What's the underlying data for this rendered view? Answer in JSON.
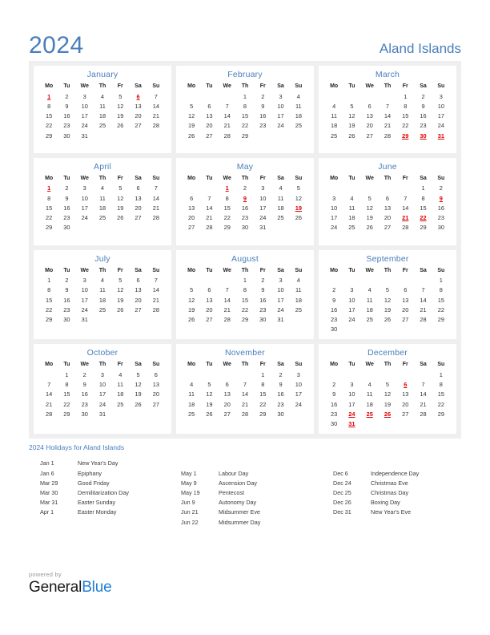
{
  "header": {
    "year": "2024",
    "country": "Aland Islands"
  },
  "calendar": {
    "weekdays": [
      "Mo",
      "Tu",
      "We",
      "Th",
      "Fr",
      "Sa",
      "Su"
    ],
    "months": [
      {
        "name": "January",
        "lead_blanks": 0,
        "days": 31,
        "holidays": [
          1,
          6
        ]
      },
      {
        "name": "February",
        "lead_blanks": 3,
        "days": 29,
        "holidays": []
      },
      {
        "name": "March",
        "lead_blanks": 4,
        "days": 31,
        "holidays": [
          29,
          30,
          31
        ]
      },
      {
        "name": "April",
        "lead_blanks": 0,
        "days": 30,
        "holidays": [
          1
        ]
      },
      {
        "name": "May",
        "lead_blanks": 2,
        "days": 31,
        "holidays": [
          1,
          9,
          19
        ]
      },
      {
        "name": "June",
        "lead_blanks": 5,
        "days": 30,
        "holidays": [
          9,
          21,
          22
        ]
      },
      {
        "name": "July",
        "lead_blanks": 0,
        "days": 31,
        "holidays": []
      },
      {
        "name": "August",
        "lead_blanks": 3,
        "days": 31,
        "holidays": []
      },
      {
        "name": "September",
        "lead_blanks": 6,
        "days": 30,
        "holidays": []
      },
      {
        "name": "October",
        "lead_blanks": 1,
        "days": 31,
        "holidays": []
      },
      {
        "name": "November",
        "lead_blanks": 4,
        "days": 30,
        "holidays": []
      },
      {
        "name": "December",
        "lead_blanks": 6,
        "days": 31,
        "holidays": [
          6,
          24,
          25,
          26,
          31
        ]
      }
    ]
  },
  "holidays_section": {
    "heading": "2024 Holidays for Aland Islands",
    "columns": [
      {
        "entries": [
          {
            "date": "Jan 1",
            "name": "New Year's Day"
          },
          {
            "date": "Jan 6",
            "name": "Epiphany"
          },
          {
            "date": "Mar 29",
            "name": "Good Friday"
          },
          {
            "date": "Mar 30",
            "name": "Demilitarization Day"
          },
          {
            "date": "Mar 31",
            "name": "Easter Sunday"
          },
          {
            "date": "Apr 1",
            "name": "Easter Monday"
          }
        ],
        "lead_spacers": 0
      },
      {
        "entries": [
          {
            "date": "May 1",
            "name": "Labour Day"
          },
          {
            "date": "May 9",
            "name": "Ascension Day"
          },
          {
            "date": "May 19",
            "name": "Pentecost"
          },
          {
            "date": "Jun 9",
            "name": "Autonomy Day"
          },
          {
            "date": "Jun 21",
            "name": "Midsummer Eve"
          },
          {
            "date": "Jun 22",
            "name": "Midsummer Day"
          }
        ],
        "lead_spacers": 1
      },
      {
        "entries": [
          {
            "date": "Dec 6",
            "name": "Independence Day"
          },
          {
            "date": "Dec 24",
            "name": "Christmas Eve"
          },
          {
            "date": "Dec 25",
            "name": "Christmas Day"
          },
          {
            "date": "Dec 26",
            "name": "Boxing Day"
          },
          {
            "date": "Dec 31",
            "name": "New Year's Eve"
          }
        ],
        "lead_spacers": 1
      }
    ]
  },
  "footer": {
    "powered_by": "powered by",
    "brand_part_1": "General",
    "brand_part_2": "Blue"
  },
  "colors": {
    "accent_blue": "#4a7ebb",
    "holiday_red": "#e00000",
    "panel_gray": "#efefef",
    "brand_blue": "#1f7fd6"
  }
}
